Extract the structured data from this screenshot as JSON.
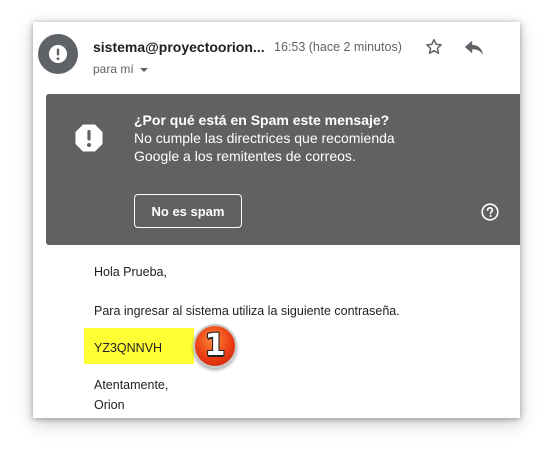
{
  "header": {
    "sender": "sistema@proyectoorion...",
    "time": "16:53 (hace 2 minutos)",
    "recipient": "para mí",
    "star_icon": "star-outline-icon",
    "reply_icon": "reply-icon"
  },
  "spam_banner": {
    "title": "¿Por qué está en Spam este mensaje?",
    "message": " No cumple las directrices que recomienda Google a los remitentes de correos.",
    "not_spam_label": "No es spam",
    "background_color": "#616161"
  },
  "message": {
    "greeting": "Hola Prueba,",
    "instruction": "Para ingresar al sistema utiliza la siguiente contraseña.",
    "password": "YZ3QNNVH",
    "highlight_color": "#ffff33",
    "closing": "Atentamente,",
    "signature": "Orion"
  },
  "annotation": {
    "number": "1",
    "color": "#ea3b12"
  }
}
